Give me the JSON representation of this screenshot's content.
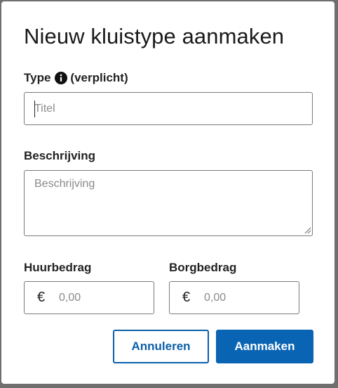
{
  "dialog": {
    "title": "Nieuw kluistype aanmaken"
  },
  "type_field": {
    "label": "Type",
    "required_text": "(verplicht)",
    "info_icon": "info-circle-icon",
    "placeholder": "Titel",
    "value": ""
  },
  "description_field": {
    "label": "Beschrijving",
    "placeholder": "Beschrijving",
    "value": ""
  },
  "rent_field": {
    "label": "Huurbedrag",
    "currency_symbol": "€",
    "placeholder": "0,00",
    "value": ""
  },
  "deposit_field": {
    "label": "Borgbedrag",
    "currency_symbol": "€",
    "placeholder": "0,00",
    "value": ""
  },
  "actions": {
    "cancel_label": "Annuleren",
    "create_label": "Aanmaken"
  },
  "colors": {
    "primary": "#0a64b4",
    "overlay": "#6f6f6f",
    "input_border": "#7a7a7a"
  }
}
